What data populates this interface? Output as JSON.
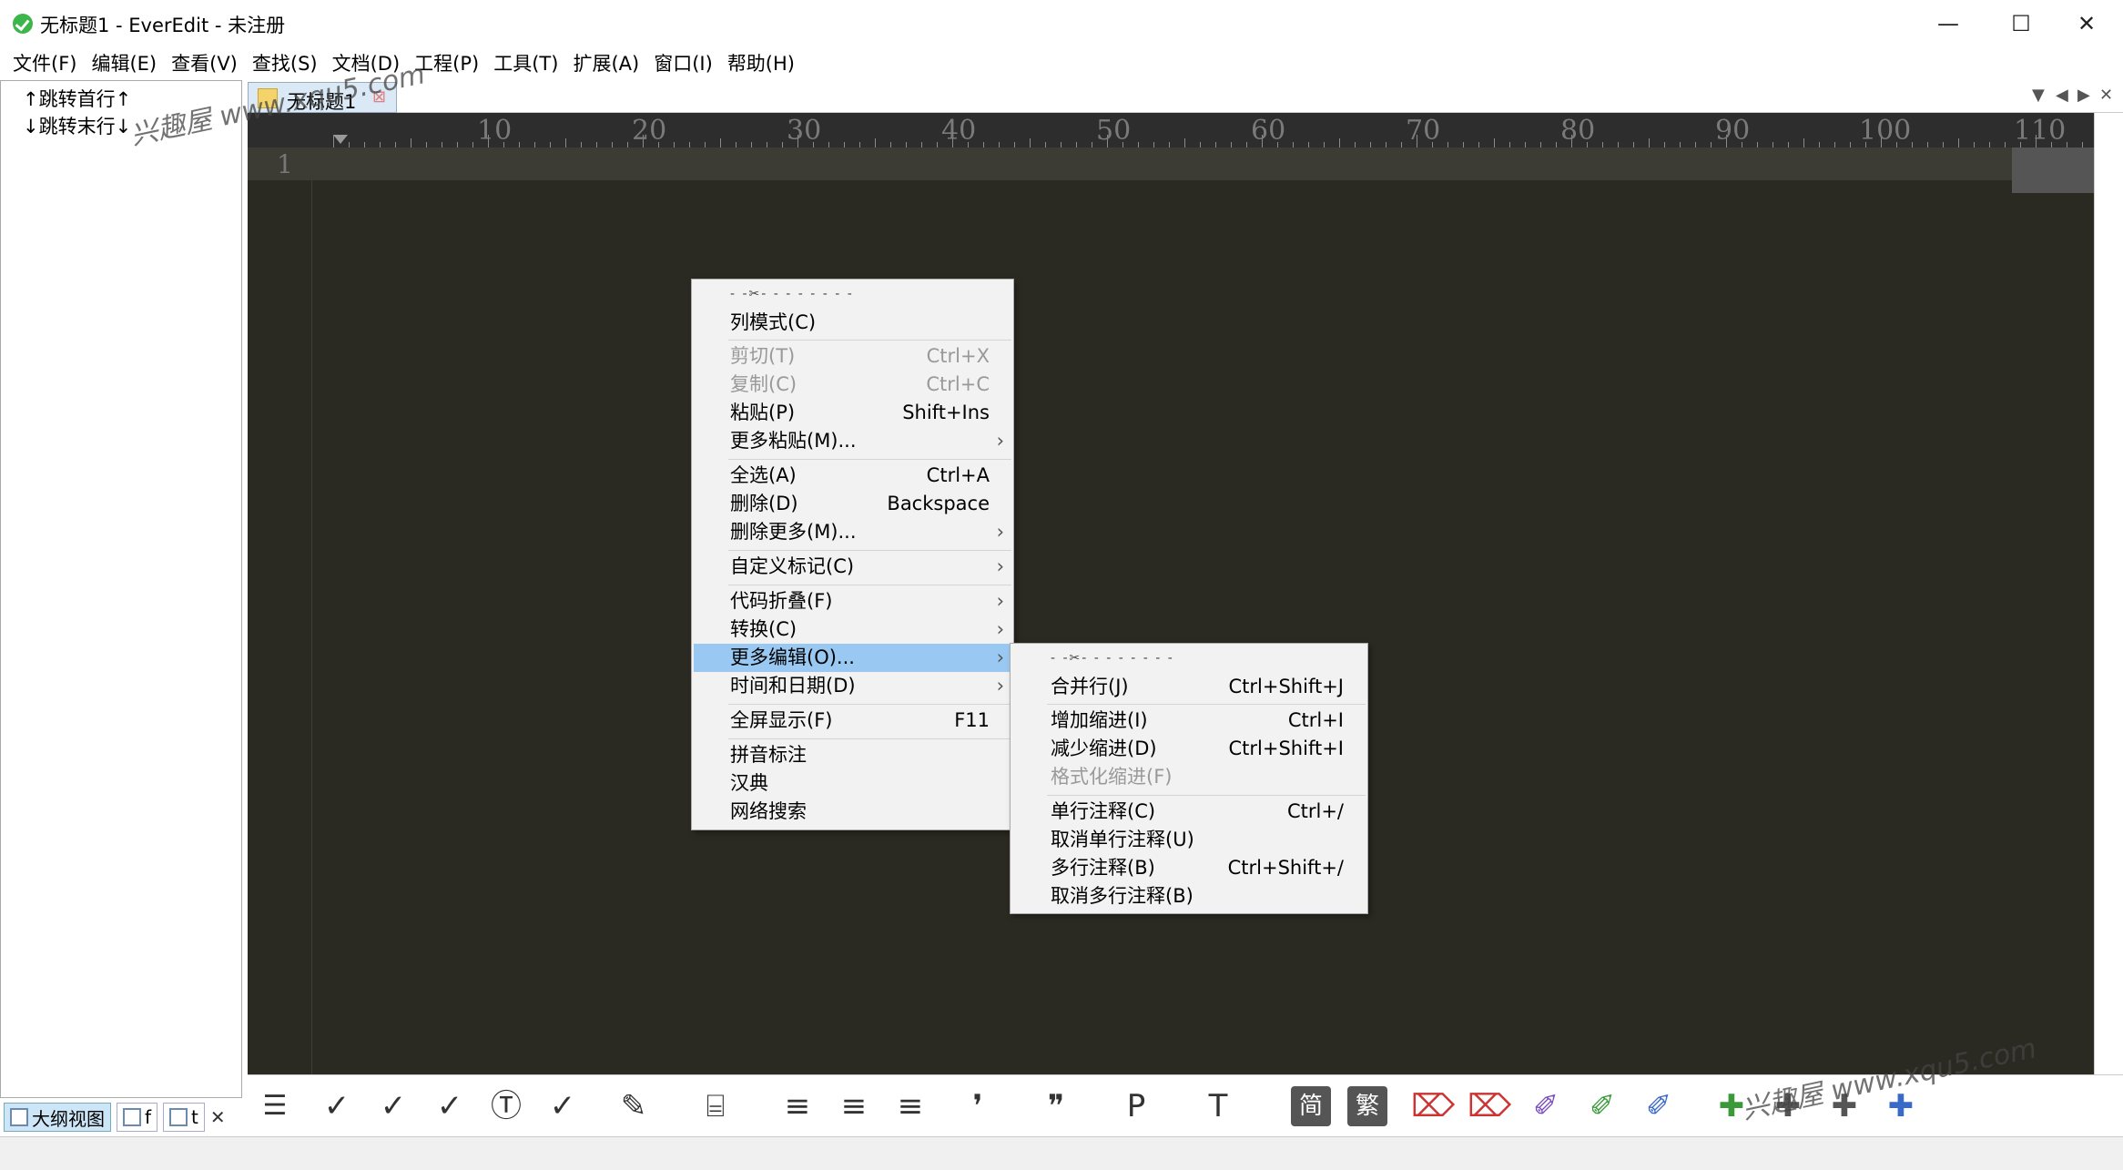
{
  "window": {
    "title": "无标题1 - EverEdit - 未注册",
    "minimize": "—",
    "maximize": "☐",
    "close": "✕"
  },
  "menubar": [
    "文件(F)",
    "编辑(E)",
    "查看(V)",
    "查找(S)",
    "文档(D)",
    "工程(P)",
    "工具(T)",
    "扩展(A)",
    "窗口(I)",
    "帮助(H)"
  ],
  "outline": {
    "items": [
      "↑跳转首行↑",
      "↓跳转末行↓"
    ],
    "tabs": [
      "大纲视图",
      "f",
      "t"
    ],
    "close": "✕"
  },
  "tab": {
    "label": "无标题1",
    "close": "⊠"
  },
  "tabnav": [
    "▼",
    "◀",
    "▶",
    "✕"
  ],
  "ruler": {
    "labels": [
      "10",
      "20",
      "30",
      "40",
      "50",
      "60",
      "70",
      "80",
      "90",
      "100",
      "110"
    ]
  },
  "editor": {
    "line_number": "1"
  },
  "context_menu": {
    "tear": "- -✂- - - - - - - -",
    "items": [
      {
        "label": "列模式(C)"
      },
      {
        "label": "剪切(T)",
        "shortcut": "Ctrl+X",
        "disabled": true
      },
      {
        "label": "复制(C)",
        "shortcut": "Ctrl+C",
        "disabled": true
      },
      {
        "label": "粘贴(P)",
        "shortcut": "Shift+Ins"
      },
      {
        "label": "更多粘贴(M)...",
        "submenu": true
      },
      {
        "label": "全选(A)",
        "shortcut": "Ctrl+A"
      },
      {
        "label": "删除(D)",
        "shortcut": "Backspace"
      },
      {
        "label": "删除更多(M)...",
        "submenu": true
      },
      {
        "label": "自定义标记(C)",
        "submenu": true
      },
      {
        "label": "代码折叠(F)",
        "submenu": true
      },
      {
        "label": "转换(C)",
        "submenu": true
      },
      {
        "label": "更多编辑(O)...",
        "submenu": true,
        "highlighted": true
      },
      {
        "label": "时间和日期(D)",
        "submenu": true
      },
      {
        "label": "全屏显示(F)",
        "shortcut": "F11"
      },
      {
        "label": "拼音标注"
      },
      {
        "label": "汉典"
      },
      {
        "label": "网络搜索"
      }
    ]
  },
  "submenu": {
    "tear": "- -✂- - - - - - - -",
    "items": [
      {
        "label": "合并行(J)",
        "shortcut": "Ctrl+Shift+J"
      },
      {
        "label": "增加缩进(I)",
        "shortcut": "Ctrl+I"
      },
      {
        "label": "减少缩进(D)",
        "shortcut": "Ctrl+Shift+I"
      },
      {
        "label": "格式化缩进(F)",
        "disabled": true
      },
      {
        "label": "单行注释(C)",
        "shortcut": "Ctrl+/"
      },
      {
        "label": "取消单行注释(U)"
      },
      {
        "label": "多行注释(B)",
        "shortcut": "Ctrl+Shift+/"
      },
      {
        "label": "取消多行注释(B)"
      }
    ]
  },
  "toolbar": {
    "icons": [
      "list-icon",
      "check-1",
      "check-2",
      "check-3",
      "check-T",
      "check-list",
      "note-icon",
      "bag-icon",
      "align-left",
      "align-center",
      "align-right",
      "quote-single",
      "quote-double",
      "P-icon",
      "T-icon",
      "简",
      "繁",
      "broom-S",
      "broom-R",
      "brush-A",
      "brush-E",
      "brush-3",
      "puzzle-S",
      "puzzle-W",
      "puzzle-F",
      "puzzle-R"
    ],
    "simplified": "简",
    "traditional": "繁"
  },
  "watermark": {
    "text1": "兴趣屋 www.xqu5.com",
    "text2": "兴趣屋 www.xqu5.com"
  }
}
